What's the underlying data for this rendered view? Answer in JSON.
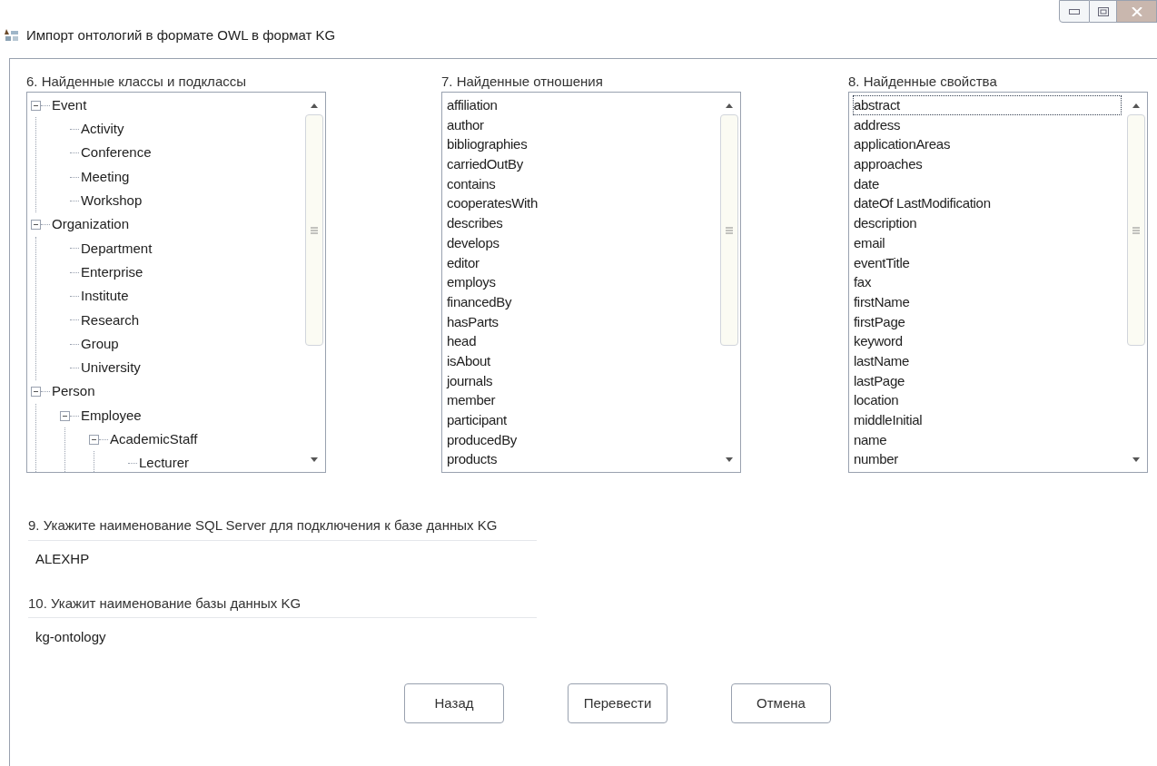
{
  "window": {
    "title": "Импорт онтологий в формате OWL в формат KG"
  },
  "panels": [
    {
      "kind": "tree",
      "label": "6. Найденные классы и подклассы",
      "nodes": [
        {
          "label": "Event",
          "expanded": true,
          "children": [
            {
              "label": "Activity"
            },
            {
              "label": "Conference"
            },
            {
              "label": "Meeting"
            },
            {
              "label": "Workshop"
            }
          ]
        },
        {
          "label": "Organization",
          "expanded": true,
          "children": [
            {
              "label": "Department"
            },
            {
              "label": "Enterprise"
            },
            {
              "label": "Institute"
            },
            {
              "label": "Research"
            },
            {
              "label": "Group"
            },
            {
              "label": "University"
            }
          ]
        },
        {
          "label": "Person",
          "expanded": true,
          "children": [
            {
              "label": "Employee",
              "expanded": true,
              "children": [
                {
                  "label": "AcademicStaff",
                  "expanded": true,
                  "children": [
                    {
                      "label": "Lecturer"
                    }
                  ]
                }
              ]
            }
          ]
        }
      ]
    },
    {
      "kind": "list",
      "label": "7. Найденные отношения",
      "items": [
        {
          "label": "affiliation",
          "focused": false
        },
        {
          "label": "author",
          "focused": false
        },
        {
          "label": "bibliographies",
          "focused": false
        },
        {
          "label": "carriedOutBy",
          "focused": false
        },
        {
          "label": "contains",
          "focused": false
        },
        {
          "label": "cooperatesWith",
          "focused": false
        },
        {
          "label": "describes",
          "focused": false
        },
        {
          "label": "develops",
          "focused": false
        },
        {
          "label": "editor",
          "focused": false
        },
        {
          "label": "employs",
          "focused": false
        },
        {
          "label": "financedBy",
          "focused": false
        },
        {
          "label": "hasParts",
          "focused": false
        },
        {
          "label": "head",
          "focused": false
        },
        {
          "label": "isAbout",
          "focused": false
        },
        {
          "label": "journals",
          "focused": false
        },
        {
          "label": "member",
          "focused": false
        },
        {
          "label": "participant",
          "focused": false
        },
        {
          "label": "producedBy",
          "focused": false
        },
        {
          "label": "products",
          "focused": false
        }
      ]
    },
    {
      "kind": "list",
      "label": "8. Найденные свойства",
      "items": [
        {
          "label": "abstract",
          "focused": true
        },
        {
          "label": "address",
          "focused": false
        },
        {
          "label": "applicationAreas",
          "focused": false
        },
        {
          "label": "approaches",
          "focused": false
        },
        {
          "label": "date",
          "focused": false
        },
        {
          "label": "dateOf LastModification",
          "focused": false
        },
        {
          "label": "description",
          "focused": false
        },
        {
          "label": "email",
          "focused": false
        },
        {
          "label": "eventTitle",
          "focused": false
        },
        {
          "label": "fax",
          "focused": false
        },
        {
          "label": "firstName",
          "focused": false
        },
        {
          "label": "firstPage",
          "focused": false
        },
        {
          "label": "keyword",
          "focused": false
        },
        {
          "label": "lastName",
          "focused": false
        },
        {
          "label": "lastPage",
          "focused": false
        },
        {
          "label": "location",
          "focused": false
        },
        {
          "label": "middleInitial",
          "focused": false
        },
        {
          "label": "name",
          "focused": false
        },
        {
          "label": "number",
          "focused": false
        }
      ]
    }
  ],
  "fields": [
    {
      "label": "9. Укажите наименование SQL Server для подключения к базе данных KG",
      "value": "ALEXHP"
    },
    {
      "label": "10. Укажит наименование базы данных KG",
      "value": "kg-ontology"
    }
  ],
  "buttons": [
    "Назад",
    "Перевести",
    "Отмена"
  ]
}
